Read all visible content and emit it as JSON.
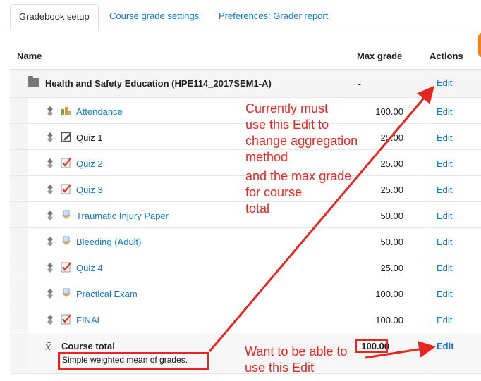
{
  "tabs": [
    {
      "label": "Gradebook setup",
      "active": true
    },
    {
      "label": "Course grade settings",
      "active": false
    },
    {
      "label": "Preferences: Grader report",
      "active": false
    }
  ],
  "columns": {
    "name": "Name",
    "max_grade": "Max grade",
    "actions": "Actions"
  },
  "category": {
    "name": "Health and Safety Education (HPE114_2017SEM1-A)",
    "max_grade": "-",
    "action": "Edit"
  },
  "items": [
    {
      "name": "Attendance",
      "icon": "attendance-icon",
      "max_grade": "100.00",
      "action": "Edit",
      "link": true
    },
    {
      "name": "Quiz 1",
      "icon": "manual-grade-icon",
      "max_grade": "25.00",
      "action": "Edit",
      "link": false
    },
    {
      "name": "Quiz 2",
      "icon": "quiz-icon",
      "max_grade": "25.00",
      "action": "Edit",
      "link": true
    },
    {
      "name": "Quiz 3",
      "icon": "quiz-icon",
      "max_grade": "25.00",
      "action": "Edit",
      "link": true
    },
    {
      "name": "Traumatic Injury Paper",
      "icon": "assignment-icon",
      "max_grade": "50.00",
      "action": "Edit",
      "link": true
    },
    {
      "name": "Bleeding (Adult)",
      "icon": "assignment-icon",
      "max_grade": "50.00",
      "action": "Edit",
      "link": true
    },
    {
      "name": "Quiz 4",
      "icon": "quiz-icon",
      "max_grade": "25.00",
      "action": "Edit",
      "link": true
    },
    {
      "name": "Practical Exam",
      "icon": "assignment-icon",
      "max_grade": "100.00",
      "action": "Edit",
      "link": true
    },
    {
      "name": "FINAL",
      "icon": "quiz-icon",
      "max_grade": "100.00",
      "action": "Edit",
      "link": true
    }
  ],
  "total": {
    "name": "Course total",
    "description": "Simple weighted mean of grades.",
    "max_grade": "100.00",
    "action": "Edit"
  },
  "annotations": {
    "top_line1": "Currently must",
    "top_line2": "use this Edit to",
    "top_line3": "change aggregation",
    "top_line4": "method",
    "top_line5": "and the max grade",
    "top_line6": "for course",
    "top_line7": "total",
    "bottom_line1": "Want to be able to",
    "bottom_line2": "use this Edit"
  },
  "colors": {
    "link": "#1177d1",
    "annotation": "#e8251f",
    "accent": "#f98012"
  }
}
